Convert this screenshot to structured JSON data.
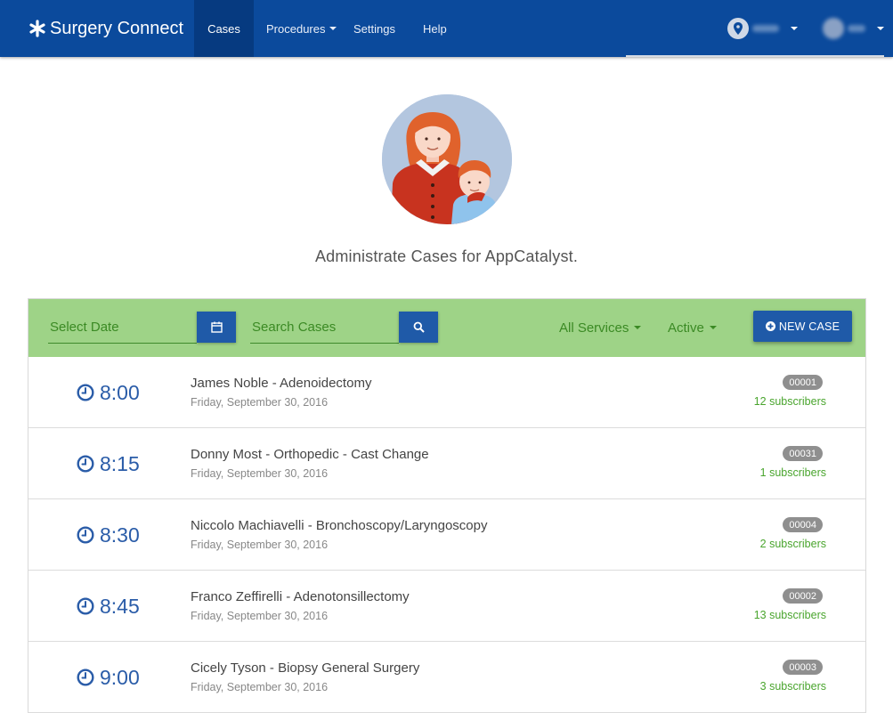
{
  "nav": {
    "brand": "Surgery Connect",
    "items": [
      {
        "label": "Cases",
        "active": true
      },
      {
        "label": "Procedures",
        "dropdown": true
      },
      {
        "label": "Settings"
      },
      {
        "label": "Help"
      }
    ],
    "location_icon": "map-pin-icon",
    "user_avatar": "user-avatar"
  },
  "hero": {
    "text": "Administrate Cases for AppCatalyst."
  },
  "toolbar": {
    "date_placeholder": "Select Date",
    "search_placeholder": "Search Cases",
    "services_filter": "All Services",
    "status_filter": "Active",
    "new_case_label": "NEW CASE",
    "accent_color": "#9ed387",
    "button_color": "#1f5aa8"
  },
  "cases": [
    {
      "time": "8:00",
      "title": "James Noble - Adenoidectomy",
      "date": "Friday, September 30, 2016",
      "id": "00001",
      "subscribers": "12 subscribers"
    },
    {
      "time": "8:15",
      "title": "Donny Most - Orthopedic - Cast Change",
      "date": "Friday, September 30, 2016",
      "id": "00031",
      "subscribers": "1 subscribers"
    },
    {
      "time": "8:30",
      "title": "Niccolo Machiavelli - Bronchoscopy/Laryngoscopy",
      "date": "Friday, September 30, 2016",
      "id": "00004",
      "subscribers": "2 subscribers"
    },
    {
      "time": "8:45",
      "title": "Franco Zeffirelli - Adenotonsillectomy",
      "date": "Friday, September 30, 2016",
      "id": "00002",
      "subscribers": "13 subscribers"
    },
    {
      "time": "9:00",
      "title": "Cicely Tyson - Biopsy General Surgery",
      "date": "Friday, September 30, 2016",
      "id": "00003",
      "subscribers": "3 subscribers"
    }
  ]
}
